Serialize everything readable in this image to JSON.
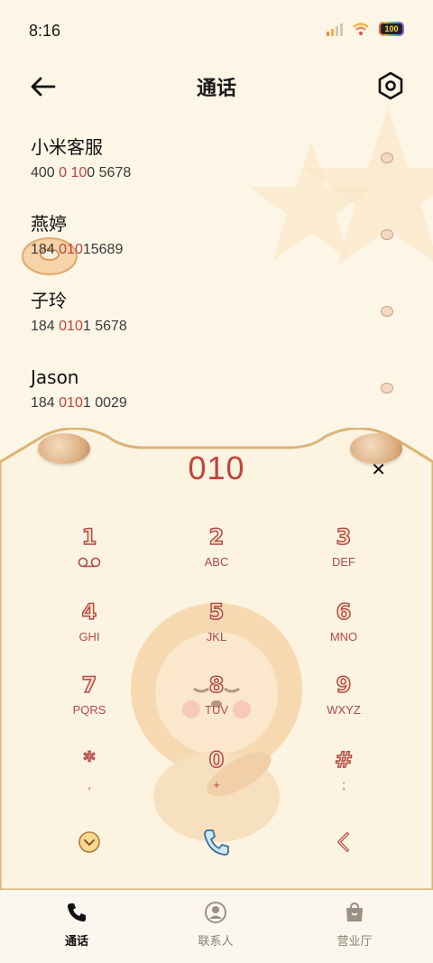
{
  "status_bar": {
    "time": "8:16",
    "battery": "100"
  },
  "header": {
    "title": "通话"
  },
  "contacts": [
    {
      "name": "小米客服",
      "number": [
        {
          "t": "400 ",
          "h": false
        },
        {
          "t": "0",
          "h": true
        },
        {
          "t": " ",
          "h": false
        },
        {
          "t": "10",
          "h": true
        },
        {
          "t": "0 5678",
          "h": false
        }
      ]
    },
    {
      "name": "燕婷",
      "number": [
        {
          "t": "184 ",
          "h": false
        },
        {
          "t": "010",
          "h": true
        },
        {
          "t": "15689",
          "h": false
        }
      ]
    },
    {
      "name": "子玲",
      "number": [
        {
          "t": "184 ",
          "h": false
        },
        {
          "t": "010",
          "h": true
        },
        {
          "t": "1 5678",
          "h": false
        }
      ]
    },
    {
      "name": "Jason",
      "number": [
        {
          "t": "184 ",
          "h": false
        },
        {
          "t": "010",
          "h": true
        },
        {
          "t": "1 0029",
          "h": false
        }
      ]
    }
  ],
  "dialpad": {
    "input": "010",
    "keys": [
      {
        "digit": "1",
        "letters": "voicemail"
      },
      {
        "digit": "2",
        "letters": "ABC"
      },
      {
        "digit": "3",
        "letters": "DEF"
      },
      {
        "digit": "4",
        "letters": "GHI"
      },
      {
        "digit": "5",
        "letters": "JKL"
      },
      {
        "digit": "6",
        "letters": "MNO"
      },
      {
        "digit": "7",
        "letters": "PQRS"
      },
      {
        "digit": "8",
        "letters": "TUV"
      },
      {
        "digit": "9",
        "letters": "WXYZ"
      },
      {
        "digit": "*",
        "letters": ","
      },
      {
        "digit": "0",
        "letters": "+"
      },
      {
        "digit": "#",
        "letters": ";"
      }
    ],
    "actions": {
      "collapse": "chevron-down-circle-icon",
      "call": "phone-icon",
      "backspace": "backspace-icon"
    }
  },
  "tabs": [
    {
      "label": "通话",
      "icon": "phone-icon",
      "active": true
    },
    {
      "label": "联系人",
      "icon": "contact-person-icon",
      "active": false
    },
    {
      "label": "营业厅",
      "icon": "store-bag-icon",
      "active": false
    }
  ],
  "colors": {
    "accent": "#c0443c",
    "background": "#fdf5e6",
    "key_text": "#b04a4a"
  }
}
